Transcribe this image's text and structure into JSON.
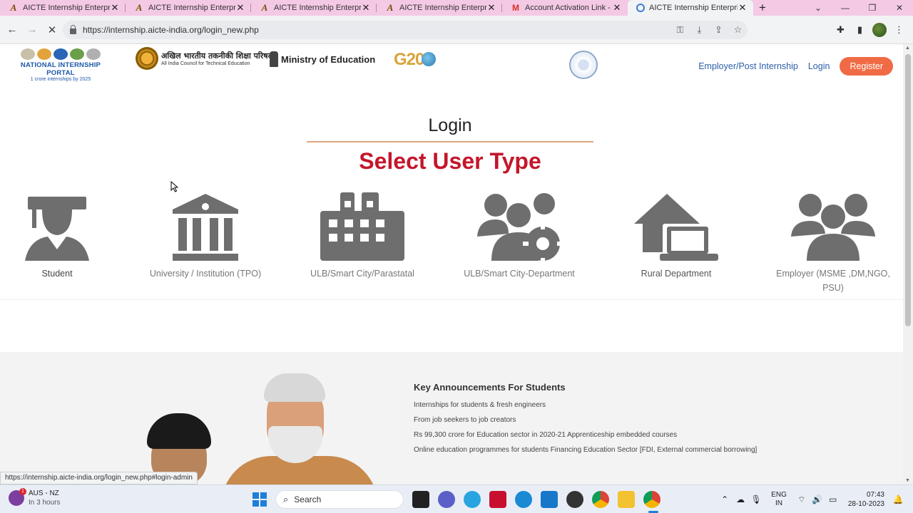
{
  "browser": {
    "tabs": [
      {
        "label": "AICTE Internship Enterprise",
        "icon": "aicte-icon",
        "active": false
      },
      {
        "label": "AICTE Internship Enterprise",
        "icon": "aicte-icon",
        "active": false
      },
      {
        "label": "AICTE Internship Enterprise",
        "icon": "aicte-icon",
        "active": false
      },
      {
        "label": "AICTE Internship Enterprise",
        "icon": "aicte-icon",
        "active": false
      },
      {
        "label": "Account Activation Link - ",
        "icon": "gmail-icon",
        "active": false
      },
      {
        "label": "AICTE Internship Enterprise",
        "icon": "chrome-loading-icon",
        "active": true
      }
    ],
    "url": "https://internship.aicte-india.org/login_new.php",
    "status_link": "https://internship.aicte-india.org/login_new.php#login-admin"
  },
  "header": {
    "nip_title": "NATIONAL INTERNSHIP PORTAL",
    "nip_sub": "1 crore internships by 2025",
    "aicte_hindi": "अखिल भारतीय तकनीकी शिक्षा परिषद्",
    "aicte_english": "All India Council for Technical Education",
    "moe": "Ministry of Education",
    "g20": "G20",
    "links": {
      "employer": "Employer/Post Internship",
      "login": "Login",
      "register": "Register"
    }
  },
  "login": {
    "title": "Login",
    "subtitle": "Select User Type",
    "user_types": [
      {
        "name": "student",
        "label": "Student",
        "icon": "graduate-icon"
      },
      {
        "name": "university",
        "label": "University / Institution (TPO)",
        "icon": "institution-icon"
      },
      {
        "name": "ulb-parastatal",
        "label": "ULB/Smart City/Parastatal",
        "icon": "city-building-icon"
      },
      {
        "name": "ulb-department",
        "label": "ULB/Smart City-Department",
        "icon": "users-gear-icon"
      },
      {
        "name": "rural",
        "label": "Rural Department",
        "icon": "house-laptop-icon"
      },
      {
        "name": "employer",
        "label": "Employer (MSME ,DM,NGO, PSU)",
        "icon": "users-group-icon"
      }
    ]
  },
  "announcements": {
    "title": "Key Announcements For Students",
    "items": [
      "Internships for students & fresh engineers",
      "From job seekers to job creators",
      "Rs 99,300 crore for Education sector in 2020-21 Apprenticeship embedded courses",
      "Online education programmes for students Financing Education Sector [FDI, External commercial borrowing]"
    ]
  },
  "taskbar": {
    "weather_title": "AUS - NZ",
    "weather_sub": "In 3 hours",
    "weather_badge": "1",
    "search_placeholder": "Search",
    "lang_top": "ENG",
    "lang_bottom": "IN",
    "time": "07:43",
    "date": "28-10-2023"
  },
  "colors": {
    "accent_red": "#c4162b",
    "register_orange": "#f06b45",
    "link_blue": "#2d5fa8",
    "icon_gray": "#6e6e6e",
    "tabbar_pink": "#f4c9e4"
  }
}
